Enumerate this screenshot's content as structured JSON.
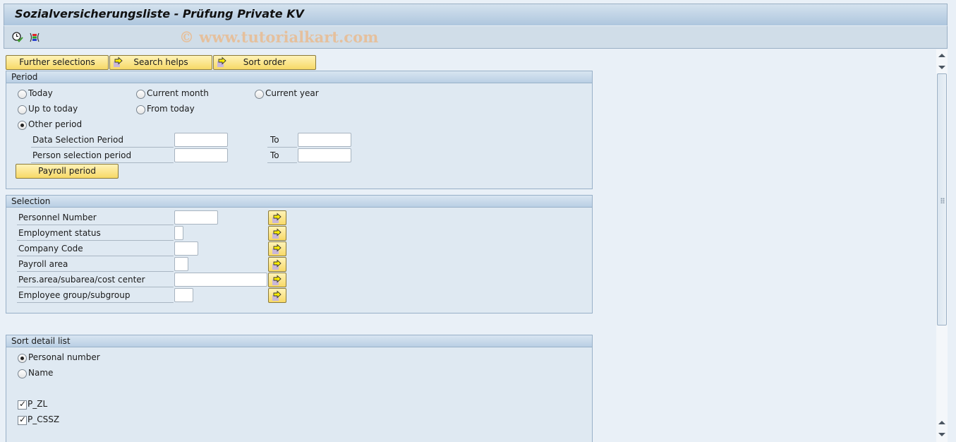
{
  "window": {
    "title": "Sozialversicherungsliste - Prüfung Private KV",
    "watermark": "© www.tutorialkart.com"
  },
  "toolbar": {
    "icons": [
      {
        "name": "execute-clock-icon",
        "semantic": "execute"
      },
      {
        "name": "selection-screen-icon",
        "semantic": "get-variant"
      }
    ]
  },
  "top_buttons": {
    "further_selections": "Further selections",
    "search_helps": "Search helps",
    "sort_order": "Sort order"
  },
  "period": {
    "title": "Period",
    "radios": {
      "today": {
        "label": "Today",
        "selected": false
      },
      "current_month": {
        "label": "Current month",
        "selected": false
      },
      "current_year": {
        "label": "Current year",
        "selected": false
      },
      "up_to_today": {
        "label": "Up to today",
        "selected": false
      },
      "from_today": {
        "label": "From today",
        "selected": false
      },
      "other_period": {
        "label": "Other period",
        "selected": true
      }
    },
    "data_selection_label": "Data Selection Period",
    "person_selection_label": "Person selection period",
    "to_label": "To",
    "data_selection_from": "",
    "data_selection_to": "",
    "person_selection_from": "",
    "person_selection_to": "",
    "payroll_period_button": "Payroll period"
  },
  "selection": {
    "title": "Selection",
    "fields": [
      {
        "label": "Personnel Number",
        "value": ""
      },
      {
        "label": "Employment status",
        "value": ""
      },
      {
        "label": "Company Code",
        "value": ""
      },
      {
        "label": "Payroll area",
        "value": ""
      },
      {
        "label": "Pers.area/subarea/cost center",
        "value": ""
      },
      {
        "label": "Employee group/subgroup",
        "value": ""
      }
    ]
  },
  "sort_detail": {
    "title": "Sort detail list",
    "radios": {
      "personal_number": {
        "label": "Personal number",
        "selected": true
      },
      "name": {
        "label": "Name",
        "selected": false
      }
    },
    "checkboxes": {
      "p_zl": {
        "label": "P_ZL",
        "checked": true
      },
      "p_cssz": {
        "label": "P_CSSZ",
        "checked": true
      }
    }
  },
  "colors": {
    "button_yellow": "#f7d967",
    "group_bg": "#dfe9f2",
    "header_blue": "#b9cfe4"
  }
}
